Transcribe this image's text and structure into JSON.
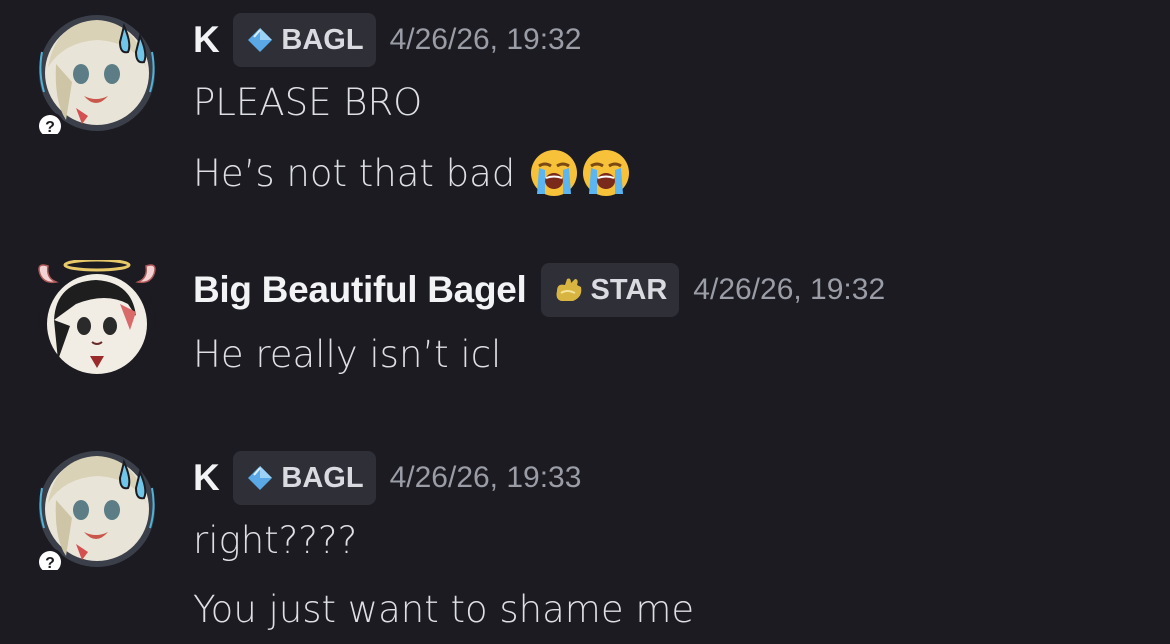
{
  "messages": [
    {
      "author": "K",
      "tag": {
        "label": "BAGL",
        "icon": "blue-droplet-icon",
        "color": "#5aa9e6"
      },
      "timestamp": "4/26/26, 19:32",
      "lines": [
        "PLEASE BRO",
        "He’s not that bad"
      ],
      "emoji": [
        "loudly-crying-face",
        "loudly-crying-face"
      ]
    },
    {
      "author": "Big Beautiful Bagel",
      "tag": {
        "label": "STAR",
        "icon": "gold-hand-icon",
        "color": "#d8b441"
      },
      "timestamp": "4/26/26, 19:32",
      "lines": [
        "He really isn’t icl"
      ]
    },
    {
      "author": "K",
      "tag": {
        "label": "BAGL",
        "icon": "blue-droplet-icon",
        "color": "#5aa9e6"
      },
      "timestamp": "4/26/26, 19:33",
      "lines": [
        "right????",
        "You just want to shame me"
      ]
    }
  ]
}
